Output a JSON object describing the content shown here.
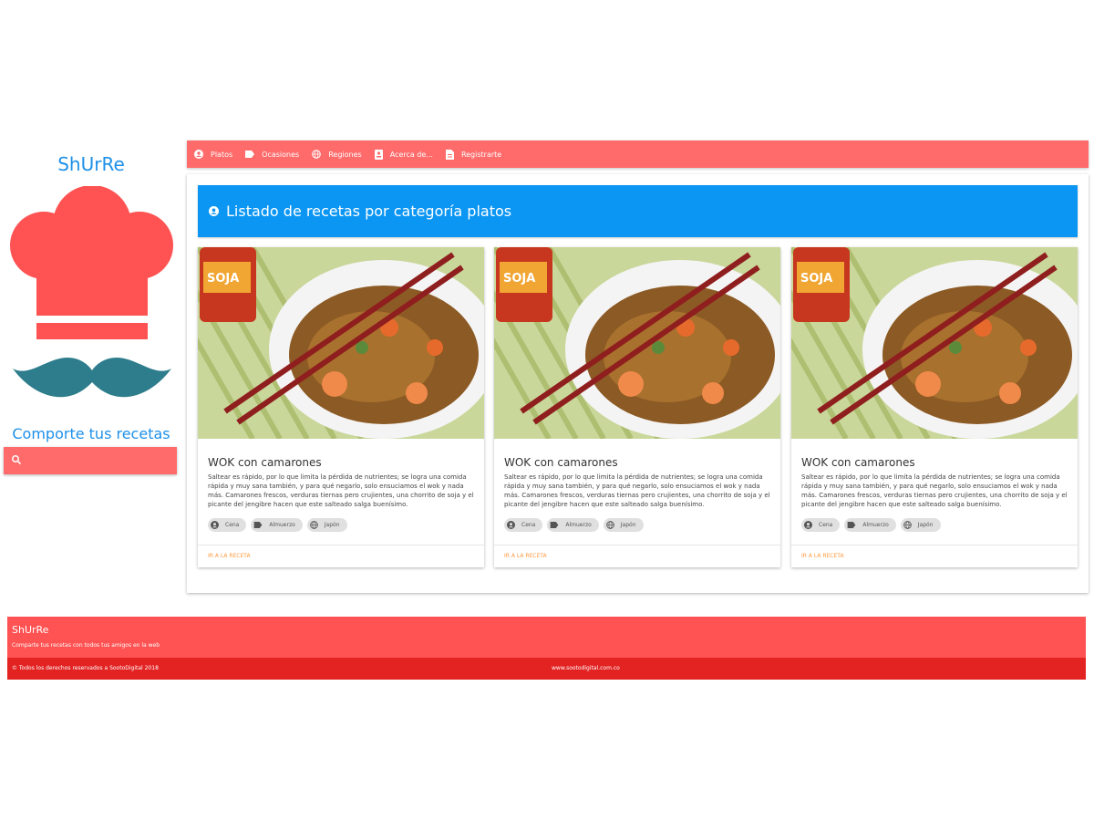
{
  "sidebar": {
    "brand": "ShUrRe",
    "tagline": "Comporte tus recetas",
    "search": {
      "value": "",
      "placeholder": ""
    },
    "colors": {
      "hat": "#ff5252",
      "mustache": "#2e7d8c",
      "brand_text": "#1e90e8"
    }
  },
  "nav": {
    "items": [
      {
        "label": "Platos",
        "icon": "account-circle-icon"
      },
      {
        "label": "Ocasiones",
        "icon": "label-icon"
      },
      {
        "label": "Regiones",
        "icon": "globe-icon"
      },
      {
        "label": "Acerca de...",
        "icon": "contact-card-icon"
      },
      {
        "label": "Registrarte",
        "icon": "document-icon"
      }
    ]
  },
  "banner": {
    "title": "Listado de recetas por categoría platos",
    "icon": "account-circle-icon"
  },
  "cards": [
    {
      "title": "WOK con camarones",
      "description": "Saltear es rápido, por lo que limita la pérdida de nutrientes; se logra una comida rápida y muy sana también, y para qué negarlo, solo ensuciamos el wok y nada más. Camarones frescos, verduras tiernas pero crujientes, una chorrito de soja y el picante del jengibre hacen que este salteado salga buenísimo.",
      "chips": [
        {
          "label": "Cena",
          "icon": "account-circle-icon"
        },
        {
          "label": "Almuerzo",
          "icon": "label-icon"
        },
        {
          "label": "Japón",
          "icon": "globe-icon"
        }
      ],
      "link": "IR A LA RECETA"
    },
    {
      "title": "WOK con camarones",
      "description": "Saltear es rápido, por lo que limita la pérdida de nutrientes; se logra una comida rápida y muy sana también, y para qué negarlo, solo ensuciamos el wok y nada más. Camarones frescos, verduras tiernas pero crujientes, una chorrito de soja y el picante del jengibre hacen que este salteado salga buenísimo.",
      "chips": [
        {
          "label": "Cena",
          "icon": "account-circle-icon"
        },
        {
          "label": "Almuerzo",
          "icon": "label-icon"
        },
        {
          "label": "Japón",
          "icon": "globe-icon"
        }
      ],
      "link": "IR A LA RECETA"
    },
    {
      "title": "WOK con camarones",
      "description": "Saltear es rápido, por lo que limita la pérdida de nutrientes; se logra una comida rápida y muy sana también, y para qué negarlo, solo ensuciamos el wok y nada más. Camarones frescos, verduras tiernas pero crujientes, una chorrito de soja y el picante del jengibre hacen que este salteado salga buenísimo.",
      "chips": [
        {
          "label": "Cena",
          "icon": "account-circle-icon"
        },
        {
          "label": "Almuerzo",
          "icon": "label-icon"
        },
        {
          "label": "Japón",
          "icon": "globe-icon"
        }
      ],
      "link": "IR A LA RECETA"
    }
  ],
  "footer": {
    "title": "ShUrRe",
    "subtitle": "Comparte tus recetas con todos tus amigos en la web",
    "copyright": "© Todos los derechos reservados a SootoDigital 2018",
    "site": "www.sootodigital.com.co",
    "colors": {
      "top": "#ff5252",
      "bottom": "#e32222"
    }
  }
}
